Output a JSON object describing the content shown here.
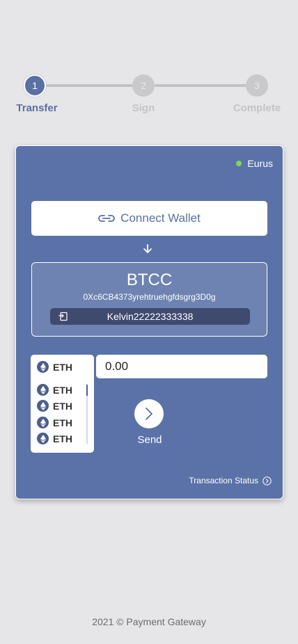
{
  "stepper": {
    "steps": [
      {
        "number": "1",
        "label": "Transfer",
        "state": "active"
      },
      {
        "number": "2",
        "label": "Sign",
        "state": "inactive"
      },
      {
        "number": "3",
        "label": "Complete",
        "state": "inactive"
      }
    ]
  },
  "card": {
    "network": {
      "name": "Eurus",
      "status_color": "#7ed957"
    },
    "connect_wallet_label": "Connect Wallet",
    "token": {
      "symbol": "BTCC",
      "address": "0Xc6CB4373yrehtruehgfdsgrg3D0g",
      "account": "Kelvin22222333338"
    },
    "coin_selector": {
      "selected": "ETH",
      "options": [
        "ETH",
        "ETH",
        "ETH",
        "ETH"
      ]
    },
    "amount": {
      "value": "0.00"
    },
    "send_label": "Send",
    "transaction_status_label": "Transaction Status"
  },
  "footer": {
    "text": "2021 © Payment Gateway"
  },
  "colors": {
    "accent": "#5a6fa3",
    "card_bg": "#5a72a8",
    "page_bg": "#e6e6e8"
  }
}
